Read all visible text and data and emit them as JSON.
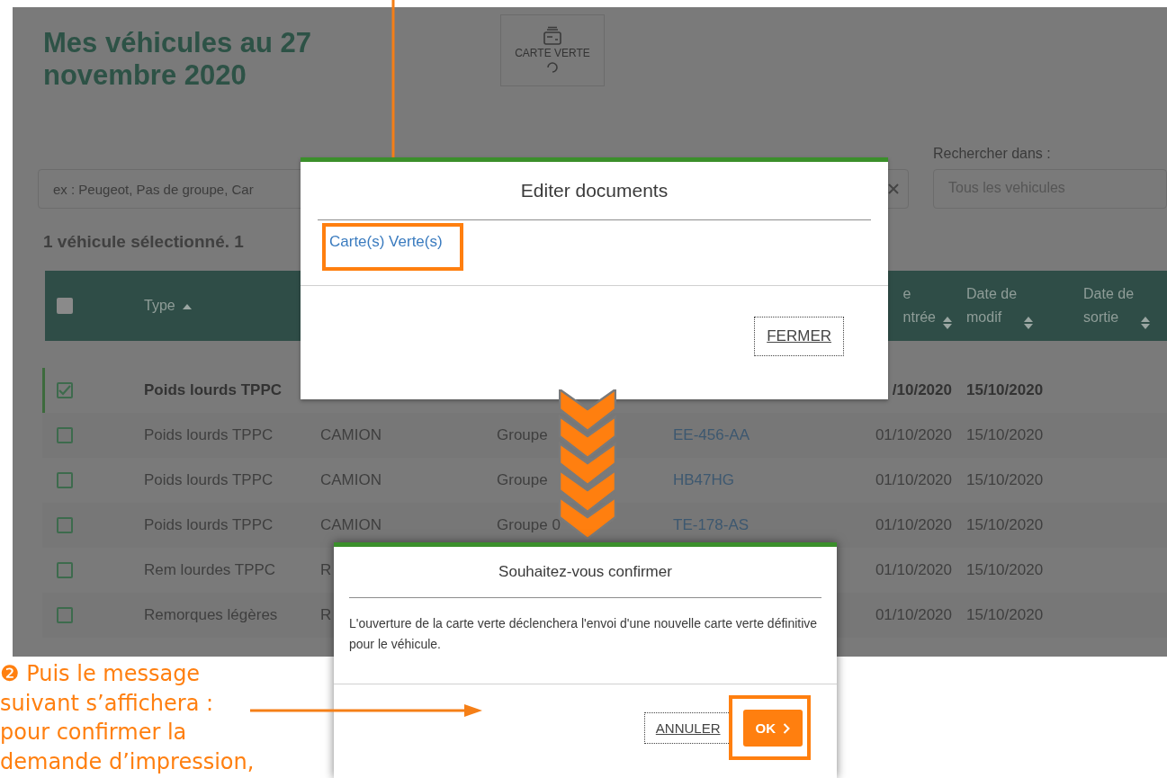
{
  "page": {
    "title": "Mes véhicules au 27 novembre 2020",
    "green_card_button": {
      "label": "CARTE VERTE",
      "loading": true
    },
    "search": {
      "placeholder": "ex : Peugeot, Pas de groupe, Car"
    },
    "scope": {
      "label": "Rechercher dans :",
      "value": "Tous les vehicules"
    },
    "selection_summary": "1 véhicule sélectionné. 1",
    "table": {
      "select_all_checked": false,
      "columns": [
        {
          "lines": [
            "Type"
          ],
          "sorted": true
        },
        {
          "lines": [
            "e",
            "ntrée"
          ],
          "sorted": false
        },
        {
          "lines": [
            "Date de",
            "modif"
          ],
          "sorted": false
        },
        {
          "lines": [
            "Date de",
            "sortie"
          ],
          "sorted": false
        }
      ],
      "rows": [
        {
          "selected": true,
          "type": "Poids lourds TPPC",
          "entry_date": "/10/2020",
          "modified_date": "15/10/2020"
        },
        {
          "selected": false,
          "type": "Poids lourds TPPC",
          "body": "CAMION",
          "group": "Groupe",
          "plate": "EE-456-AA",
          "entry_date": "01/10/2020",
          "modified_date": "15/10/2020"
        },
        {
          "selected": false,
          "type": "Poids lourds TPPC",
          "body": "CAMION",
          "group": "Groupe",
          "plate": "HB47HG",
          "entry_date": "01/10/2020",
          "modified_date": "15/10/2020"
        },
        {
          "selected": false,
          "type": "Poids lourds TPPC",
          "body": "CAMION",
          "group": "Groupe 0",
          "plate": "TE-178-AS",
          "entry_date": "01/10/2020",
          "modified_date": "15/10/2020"
        },
        {
          "selected": false,
          "type": "Rem lourdes TPPC",
          "body": "R",
          "entry_date": "01/10/2020",
          "modified_date": "15/10/2020"
        },
        {
          "selected": false,
          "type": "Remorques légères",
          "body": "R",
          "entry_date": "01/10/2020",
          "modified_date": "15/10/2020"
        }
      ]
    }
  },
  "documents_dialog": {
    "title": "Editer documents",
    "links": [
      "Carte(s) Verte(s)"
    ],
    "close_button": "FERMER"
  },
  "confirm_dialog": {
    "title": "Souhaitez-vous confirmer",
    "message": "L'ouverture de la carte verte déclenchera l'envoi d'une nouvelle carte verte définitive pour le véhicule.",
    "cancel_button": "ANNULER",
    "ok_button": "OK"
  },
  "annotation": {
    "lines": [
      "❷ Puis le message",
      "suivant s’affichera :",
      "pour confirmer la",
      "demande d’impression,"
    ]
  }
}
